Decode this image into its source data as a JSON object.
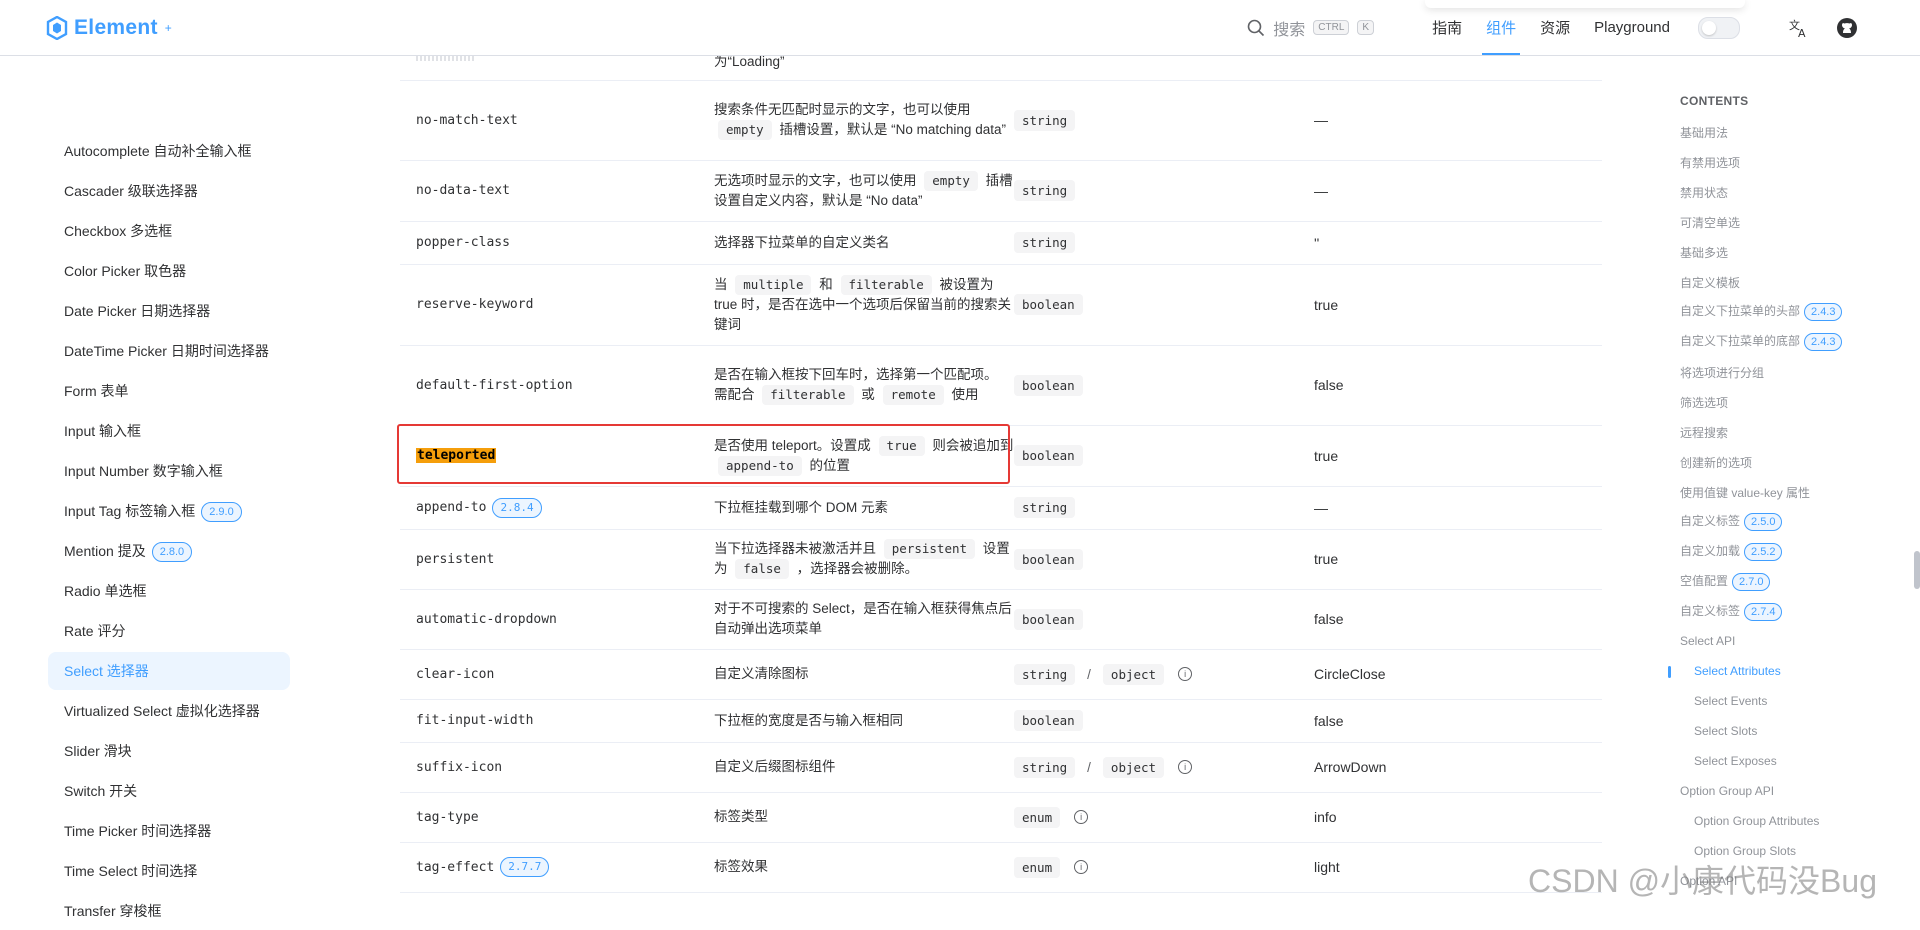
{
  "header": {
    "logo_text": "Element",
    "logo_sup": "+",
    "search_label": "搜索",
    "search_key1": "CTRL",
    "search_key2": "K",
    "nav": [
      "指南",
      "组件",
      "资源",
      "Playground"
    ],
    "active_nav": "组件"
  },
  "sidebar": {
    "items": [
      {
        "label": "Autocomplete 自动补全输入框"
      },
      {
        "label": "Cascader 级联选择器"
      },
      {
        "label": "Checkbox 多选框"
      },
      {
        "label": "Color Picker 取色器"
      },
      {
        "label": "Date Picker 日期选择器"
      },
      {
        "label": "DateTime Picker 日期时间选择器"
      },
      {
        "label": "Form 表单"
      },
      {
        "label": "Input 输入框"
      },
      {
        "label": "Input Number 数字输入框"
      },
      {
        "label": "Input Tag 标签输入框",
        "badge": "2.9.0"
      },
      {
        "label": "Mention 提及",
        "badge": "2.8.0"
      },
      {
        "label": "Radio 单选框"
      },
      {
        "label": "Rate 评分"
      },
      {
        "label": "Select 选择器",
        "active": true
      },
      {
        "label": "Virtualized Select 虚拟化选择器"
      },
      {
        "label": "Slider 滑块"
      },
      {
        "label": "Switch 开关"
      },
      {
        "label": "Time Picker 时间选择器"
      },
      {
        "label": "Time Select 时间选择"
      },
      {
        "label": "Transfer 穿梭框"
      }
    ]
  },
  "table": {
    "top_fragment": "为“Loading”",
    "rows": [
      {
        "name": "no-match-text",
        "desc": [
          "搜索条件无匹配时显示的文字，也可以使用",
          {
            "code": "empty"
          },
          "插槽设置，默认是 “No matching data”"
        ],
        "type": [
          "string"
        ],
        "default": "—"
      },
      {
        "name": "no-data-text",
        "desc": [
          "无选项时显示的文字，也可以使用",
          {
            "code": "empty"
          },
          "插槽设置自定义内容，默认是 “No data”"
        ],
        "type": [
          "string"
        ],
        "default": "—"
      },
      {
        "name": "popper-class",
        "desc": [
          "选择器下拉菜单的自定义类名"
        ],
        "type": [
          "string"
        ],
        "default": "''"
      },
      {
        "name": "reserve-keyword",
        "desc": [
          "当",
          {
            "code": "multiple"
          },
          "和",
          {
            "code": "filterable"
          },
          "被设置为 true 时，是否在选中一个选项后保留当前的搜索关键词"
        ],
        "type": [
          "boolean"
        ],
        "default": "true"
      },
      {
        "name": "default-first-option",
        "desc": [
          "是否在输入框按下回车时，选择第一个匹配项。 需配合",
          {
            "code": "filterable"
          },
          "或",
          {
            "code": "remote"
          },
          "使用"
        ],
        "type": [
          "boolean"
        ],
        "default": "false"
      },
      {
        "name": "teleported",
        "highlight": true,
        "desc": [
          "是否使用 teleport。设置成",
          {
            "code": "true"
          },
          "则会被追加到",
          {
            "code": "append-to"
          },
          "的位置"
        ],
        "type": [
          "boolean"
        ],
        "default": "true"
      },
      {
        "name": "append-to",
        "badge": "2.8.4",
        "desc": [
          "下拉框挂载到哪个 DOM 元素"
        ],
        "type": [
          "string"
        ],
        "default": "—"
      },
      {
        "name": "persistent",
        "desc": [
          "当下拉选择器未被激活并且",
          {
            "code": "persistent"
          },
          "设置为",
          {
            "code": "false"
          },
          "，选择器会被删除。"
        ],
        "type": [
          "boolean"
        ],
        "default": "true"
      },
      {
        "name": "automatic-dropdown",
        "desc": [
          "对于不可搜索的 Select，是否在输入框获得焦点后自动弹出选项菜单"
        ],
        "type": [
          "boolean"
        ],
        "default": "false"
      },
      {
        "name": "clear-icon",
        "desc": [
          "自定义清除图标"
        ],
        "type": [
          "string",
          "object"
        ],
        "info": true,
        "default": "CircleClose"
      },
      {
        "name": "fit-input-width",
        "desc": [
          "下拉框的宽度是否与输入框相同"
        ],
        "type": [
          "boolean"
        ],
        "default": "false"
      },
      {
        "name": "suffix-icon",
        "desc": [
          "自定义后缀图标组件"
        ],
        "type": [
          "string",
          "object"
        ],
        "info": true,
        "default": "ArrowDown"
      },
      {
        "name": "tag-type",
        "desc": [
          "标签类型"
        ],
        "type": [
          "enum"
        ],
        "info": true,
        "default": "info"
      },
      {
        "name": "tag-effect",
        "badge": "2.7.7",
        "desc": [
          "标签效果"
        ],
        "type": [
          "enum"
        ],
        "info": true,
        "default": "light"
      }
    ]
  },
  "toc": {
    "title": "CONTENTS",
    "items": [
      {
        "label": "基础用法"
      },
      {
        "label": "有禁用选项"
      },
      {
        "label": "禁用状态"
      },
      {
        "label": "可清空单选"
      },
      {
        "label": "基础多选"
      },
      {
        "label": "自定义模板"
      },
      {
        "label": "自定义下拉菜单的头部",
        "badge": "2.4.3"
      },
      {
        "label": "自定义下拉菜单的底部",
        "badge": "2.4.3"
      },
      {
        "label": "将选项进行分组"
      },
      {
        "label": "筛选选项"
      },
      {
        "label": "远程搜索"
      },
      {
        "label": "创建新的选项"
      },
      {
        "label": "使用值键 value-key 属性"
      },
      {
        "label": "自定义标签",
        "badge": "2.5.0"
      },
      {
        "label": "自定义加载",
        "badge": "2.5.2"
      },
      {
        "label": "空值配置",
        "badge": "2.7.0"
      },
      {
        "label": "自定义标签",
        "badge": "2.7.4"
      },
      {
        "label": "Select API"
      },
      {
        "label": "Select Attributes",
        "sub": true,
        "active": true
      },
      {
        "label": "Select Events",
        "sub": true
      },
      {
        "label": "Select Slots",
        "sub": true
      },
      {
        "label": "Select Exposes",
        "sub": true
      },
      {
        "label": "Option Group API"
      },
      {
        "label": "Option Group Attributes",
        "sub": true
      },
      {
        "label": "Option Group Slots",
        "sub": true
      },
      {
        "label": "Option API"
      }
    ]
  },
  "watermark": "CSDN @小康代码没Bug",
  "colors": {
    "accent": "#409eff",
    "highlight": "#f59e0b",
    "box": "#e53935"
  }
}
